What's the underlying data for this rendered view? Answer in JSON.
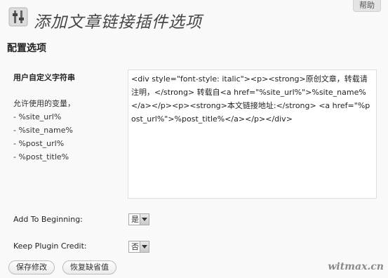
{
  "help_label": "帮助",
  "page_title": "添加文章链接插件选项",
  "section_title": "配置选项",
  "custom_string_label": "用户自定义字符串",
  "vars": {
    "heading": "允许使用的变量，",
    "items": [
      "- %site_url%",
      "- %site_name%",
      "- %post_url%",
      "- %post_title%"
    ]
  },
  "template_text": "<div style=\"font-style: italic\"><p><strong>原创文章，转载请注明，</strong> 转载自<a href=\"%site_url%\">%site_name%</a></p><p><strong>本文链接地址:</strong> <a href=\"%post_url%\">%post_title%</a></p></div>",
  "add_to_beginning": {
    "label": "Add To Beginning:",
    "value": "是"
  },
  "keep_plugin_credit": {
    "label": "Keep Plugin Credit:",
    "value": "否"
  },
  "buttons": {
    "save": "保存修改",
    "reset": "恢复缺省值"
  },
  "watermark": "witmax.cn"
}
